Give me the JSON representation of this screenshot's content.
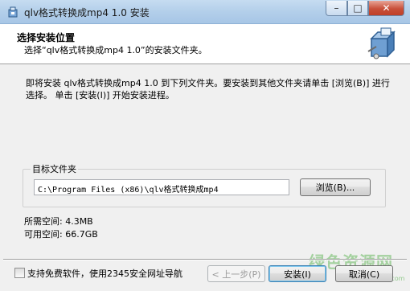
{
  "window": {
    "title": "qlv格式转换成mp4 1.0 安装",
    "close_glyph": "✕",
    "min_glyph": "–",
    "max_glyph": "□"
  },
  "header": {
    "title": "选择安装位置",
    "subtitle": "选择“qlv格式转换成mp4 1.0”的安装文件夹。"
  },
  "intro_text": "即将安装 qlv格式转换成mp4 1.0 到下列文件夹。要安装到其他文件夹请单击 [浏览(B)] 进行选择。 单击 [安装(I)] 开始安装进程。",
  "destination": {
    "label": "目标文件夹",
    "path": "C:\\Program Files (x86)\\qlv格式转换成mp4",
    "browse_label": "浏览(B)..."
  },
  "space": {
    "required": "所需空间: 4.3MB",
    "available": "可用空间: 66.7GB"
  },
  "footer": {
    "checkbox_label": "支持免费软件，使用2345安全网址导航",
    "checkbox_checked": false,
    "back_label": "< 上一步(P)",
    "install_label": "安装(I)",
    "cancel_label": "取消(C)"
  },
  "watermark": {
    "text": "绿色资源网",
    "url": "www.downcc.com"
  },
  "icons": {
    "app": "installer-icon",
    "header": "installer-box-icon"
  }
}
